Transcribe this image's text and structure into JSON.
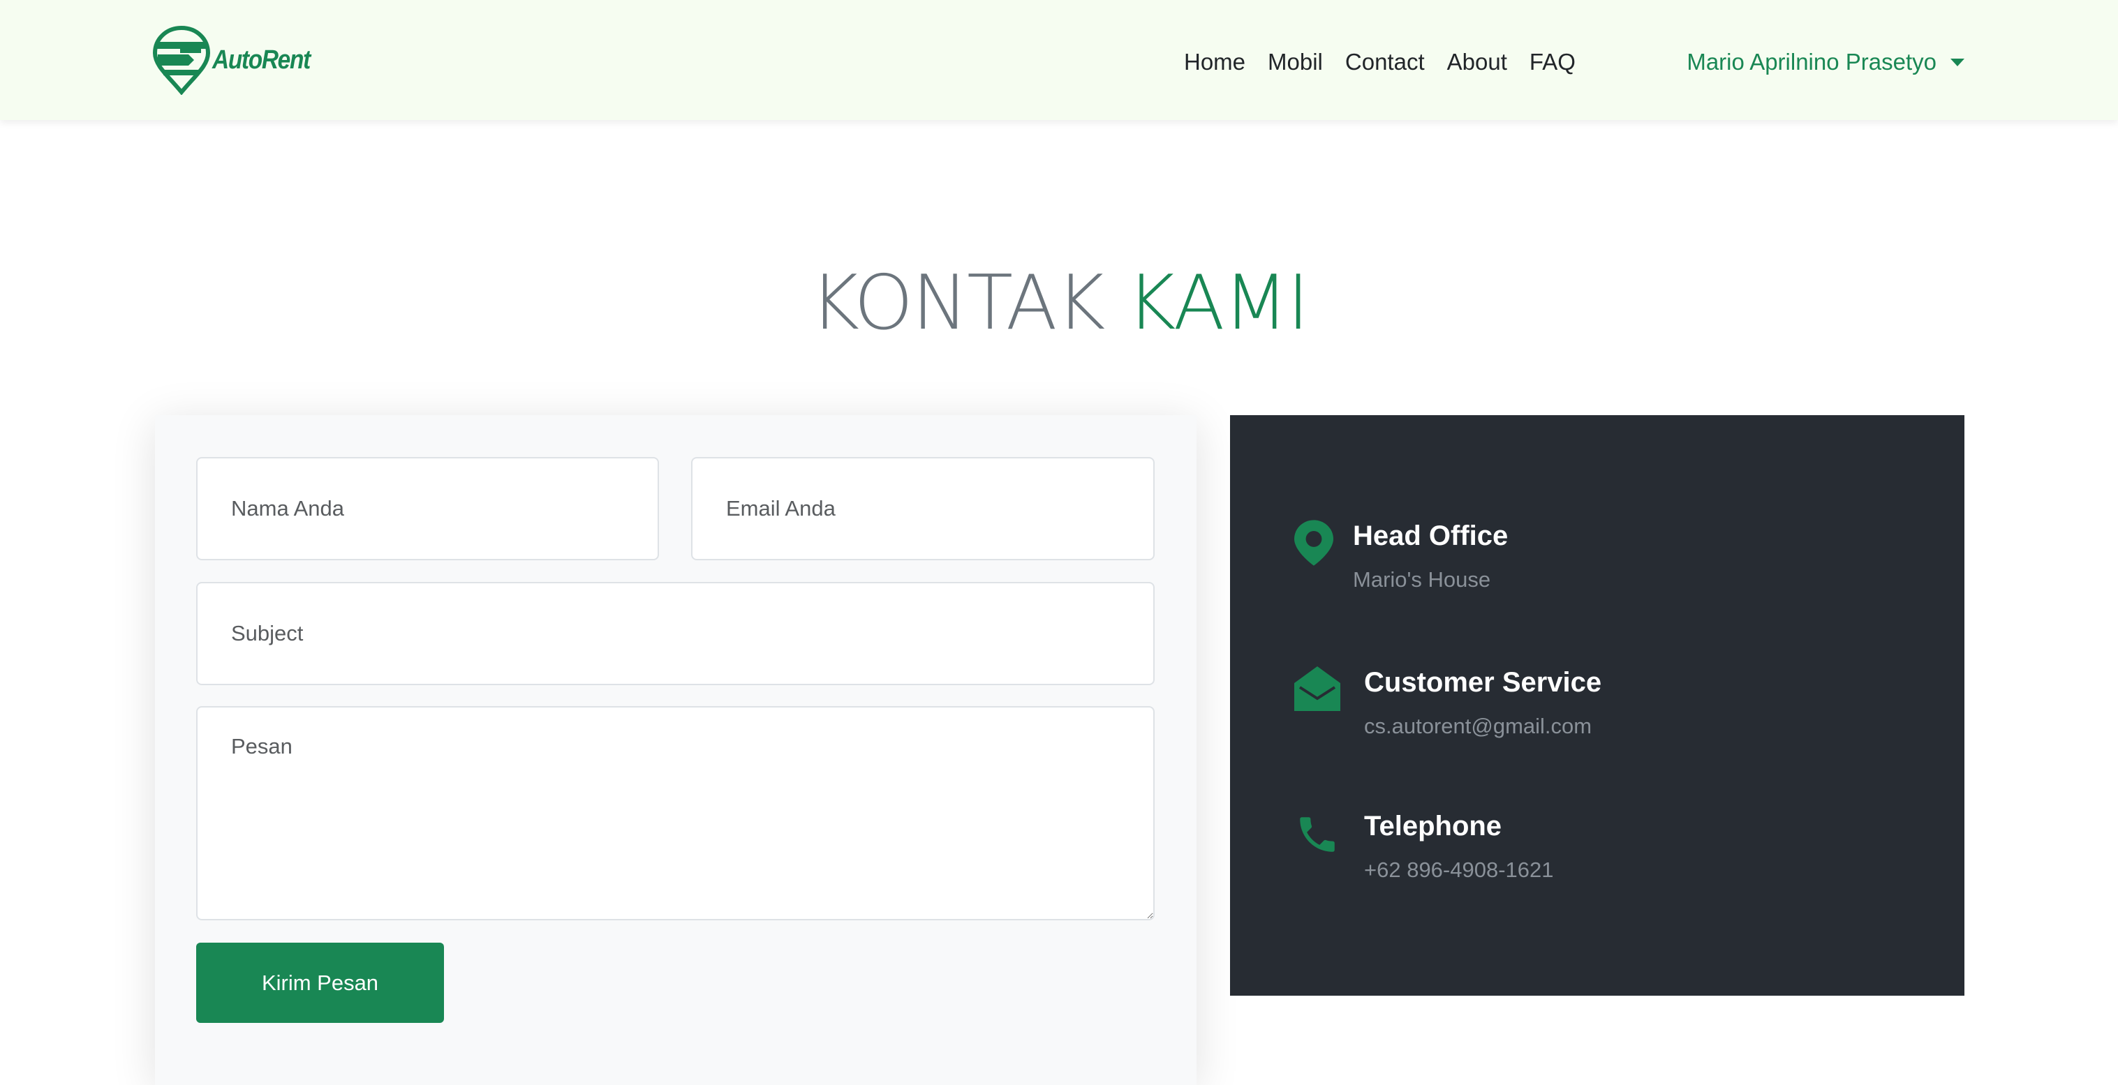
{
  "brand": {
    "name": "AutoRent"
  },
  "nav": {
    "links": [
      "Home",
      "Mobil",
      "Contact",
      "About",
      "FAQ"
    ],
    "user": "Mario Aprilnino Prasetyo"
  },
  "heading": {
    "part1": "KONTAK",
    "part2": "KAMI"
  },
  "form": {
    "name_placeholder": "Nama Anda",
    "email_placeholder": "Email Anda",
    "subject_placeholder": "Subject",
    "message_placeholder": "Pesan",
    "submit_label": "Kirim Pesan"
  },
  "contact": {
    "office": {
      "icon": "map-pin-icon",
      "title": "Head Office",
      "value": "Mario's House"
    },
    "service": {
      "icon": "envelope-open-icon",
      "title": "Customer Service",
      "value": "cs.autorent@gmail.com"
    },
    "phone": {
      "icon": "phone-icon",
      "title": "Telephone",
      "value": "+62 896-4908-1621"
    }
  },
  "colors": {
    "accent": "#198754",
    "navbar_bg": "#f6fdf1",
    "panel_bg": "#272c33",
    "title_gray": "#6c757d"
  }
}
